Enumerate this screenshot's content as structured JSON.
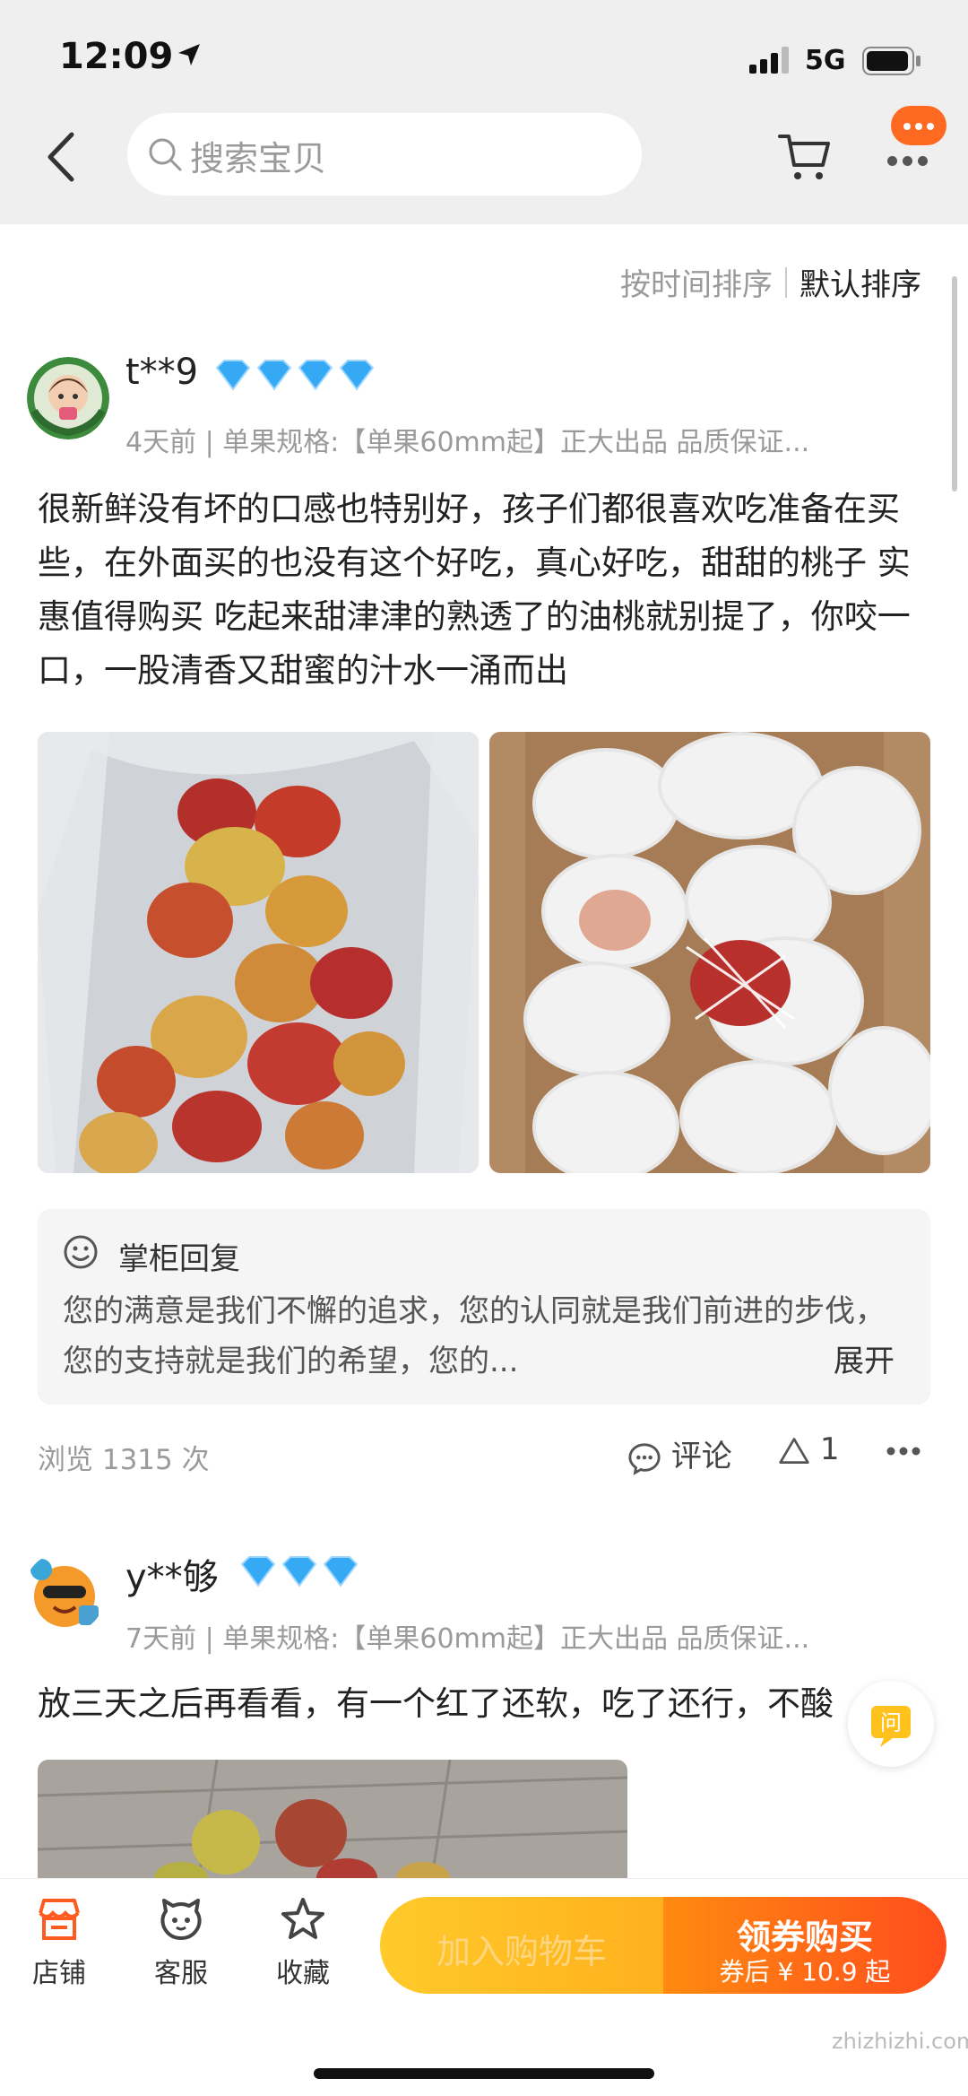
{
  "status": {
    "time": "12:09",
    "network": "5G"
  },
  "header": {
    "search_placeholder": "搜索宝贝"
  },
  "sort": {
    "by_time": "按时间排序",
    "default": "默认排序"
  },
  "reviews": [
    {
      "user": "t**9",
      "meta": "4天前 | 单果规格:【单果60mm起】正大出品 品质保证...",
      "text": "很新鲜没有坏的口感也特别好，孩子们都很喜欢吃准备在买些，在外面买的也没有这个好吃，真心好吃，甜甜的桃子 实惠值得购买 吃起来甜津津的熟透了的油桃就别提了，你咬一口，一股清香又甜蜜的汁水一涌而出",
      "reply_title": "掌柜回复",
      "reply_text": "您的满意是我们不懈的追求，您的认同就是我们前进的步伐，您的支持就是我们的希望，您的...",
      "reply_expand": "展开",
      "views": "浏览 1315 次",
      "comment_label": "评论",
      "likes": "1"
    },
    {
      "user": "y**够",
      "meta": "7天前 | 单果规格:【单果60mm起】正大出品 品质保证...",
      "text": "放三天之后再看看，有一个红了还软，吃了还行，不酸"
    }
  ],
  "float_button": {
    "label": "问"
  },
  "bottom": {
    "tabs": [
      {
        "label": "店铺",
        "icon": "store-icon"
      },
      {
        "label": "客服",
        "icon": "customer-service-icon"
      },
      {
        "label": "收藏",
        "icon": "star-icon"
      }
    ],
    "add_cart": "加入购物车",
    "buy_label": "领券购买",
    "buy_price": "券后 ¥ 10.9 起"
  },
  "watermark": "zhizhizhi.com",
  "colors": {
    "accent": "#ff5000",
    "diamond": "#36a9f5",
    "button_yellow": "#ffc125"
  }
}
